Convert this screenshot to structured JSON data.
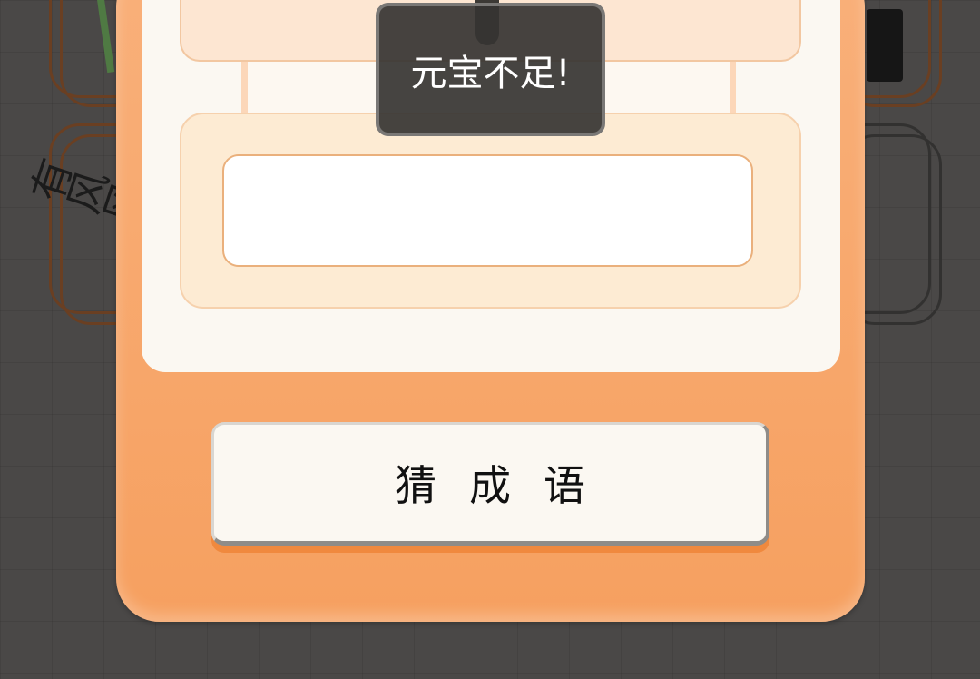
{
  "toast": {
    "message": "元宝不足!"
  },
  "answer": {
    "value": "",
    "placeholder": ""
  },
  "guess_button": {
    "label": "猜成语"
  },
  "background_tiles": {
    "left_tile_glyphs": "有风风"
  },
  "colors": {
    "dialog_orange": "#f6a060",
    "panel_cream": "#fbf8f2",
    "box_peach": "#fdebd3",
    "button_shadow": "#f0893e",
    "toast_bg": "#363432"
  }
}
